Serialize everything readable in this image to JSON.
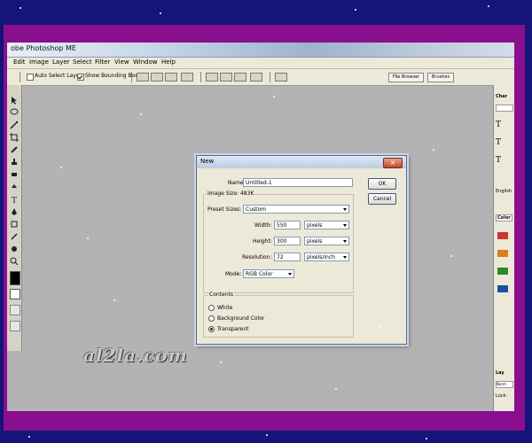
{
  "app": {
    "title": "obe Photoshop ME"
  },
  "menu": [
    "Edit",
    "Image",
    "Layer",
    "Select",
    "Filter",
    "View",
    "Window",
    "Help"
  ],
  "options_bar": {
    "auto_select_layer": "Auto Select Layer",
    "show_bounding_box": "Show Bounding Box",
    "tabs": [
      "File Browser",
      "Brushes"
    ]
  },
  "dialog": {
    "title": "New",
    "name_label": "Name:",
    "name_value": "Untitled-1",
    "ok_label": "OK",
    "cancel_label": "Cancel",
    "image_size_label": "Image Size: 483K",
    "preset_label": "Preset Sizes:",
    "preset_value": "Custom",
    "width_label": "Width:",
    "width_value": "550",
    "width_unit": "pixels",
    "height_label": "Height:",
    "height_value": "300",
    "height_unit": "pixels",
    "resolution_label": "Resolution:",
    "resolution_value": "72",
    "resolution_unit": "pixels/inch",
    "mode_label": "Mode:",
    "mode_value": "RGB Color",
    "contents_label": "Contents",
    "contents": [
      "White",
      "Background Color",
      "Transparent"
    ],
    "contents_selected": "Transparent"
  },
  "right_panel": {
    "items": [
      "Char",
      "Color",
      "Lay",
      "Norm",
      "Lock:",
      "English"
    ]
  },
  "watermark": "al2la.com",
  "colors": {
    "border_purple": "#8a0f8f",
    "background_blue": "#14147a",
    "canvas_gray": "#b3b3b3"
  }
}
